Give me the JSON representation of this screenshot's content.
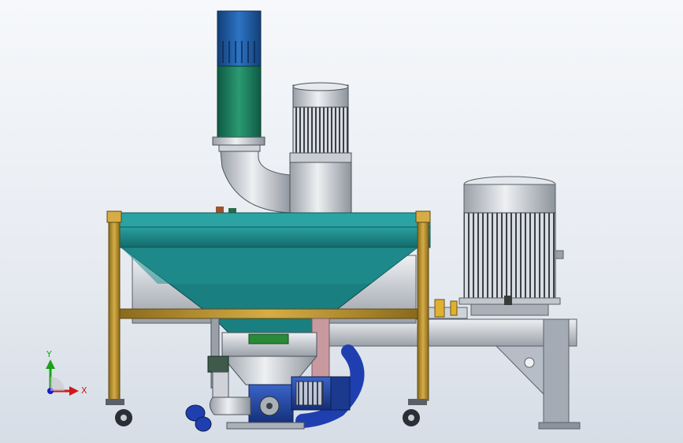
{
  "viewport": {
    "background_top": "#f6f8fb",
    "background_bottom": "#d6dde6"
  },
  "triad": {
    "y_label": "Y",
    "x_label": "X",
    "y_color": "#1aa21a",
    "x_color": "#d01818",
    "z_color": "#1a1ad0"
  },
  "colors": {
    "frame_yellow": "#b58f2a",
    "hopper_teal": "#1e8c8c",
    "duct_blue": "#1c5ea8",
    "duct_green": "#1f7a5a",
    "motor_grey": "#c9ccd2",
    "motor_blue": "#1c3f9a",
    "support_grey": "#9aa1ab",
    "hose_blue": "#1f3fb0",
    "pipe_pink": "#c89aa0"
  },
  "icons": [
    "triad-icon",
    "caster-icon",
    "motor-icon"
  ]
}
